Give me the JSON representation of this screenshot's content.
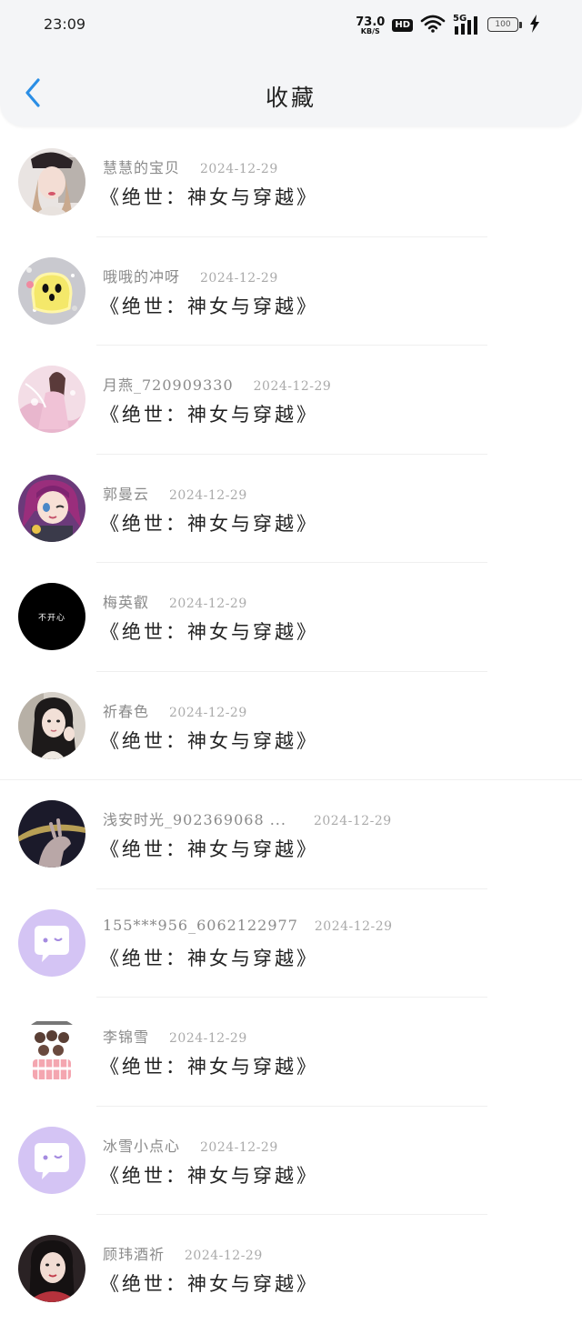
{
  "status_bar": {
    "time": "23:09",
    "net_speed": "73.0",
    "net_unit": "KB/S",
    "hd": "HD",
    "signal": "5G",
    "battery": "100"
  },
  "header": {
    "title": "收藏"
  },
  "colors": {
    "accent": "#2a8ee5",
    "bg": "#ffffff",
    "header_bg": "#f4f5f7"
  },
  "items": [
    {
      "name": "慧慧的宝贝",
      "date": "2024-12-29",
      "book": "《绝世：神女与穿越》",
      "avatar_icon": "photo-girl-red-beret-icon"
    },
    {
      "name": "哦哦的冲呀",
      "date": "2024-12-29",
      "book": "《绝世：神女与穿越》",
      "avatar_icon": "cartoon-chick-icon"
    },
    {
      "name": "月燕_720909330",
      "date": "2024-12-29",
      "book": "《绝世：神女与穿越》",
      "avatar_icon": "anime-fairy-pink-icon"
    },
    {
      "name": "郭曼云",
      "date": "2024-12-29",
      "book": "《绝世：神女与穿越》",
      "avatar_icon": "anime-girl-purple-icon"
    },
    {
      "name": "梅英叡",
      "date": "2024-12-29",
      "book": "《绝世：神女与穿越》",
      "avatar_icon": "black-circle-text-icon",
      "avatar_text": "不开心"
    },
    {
      "name": "祈春色",
      "date": "2024-12-29",
      "book": "《绝世：神女与穿越》",
      "avatar_icon": "photo-girl-longhair-icon"
    },
    {
      "name": "浅安时光_902369068 ...",
      "date": "2024-12-29",
      "book": "《绝世：神女与穿越》",
      "avatar_icon": "dark-hand-photo-icon"
    },
    {
      "name": "155***956_6062122977",
      "date": "2024-12-29",
      "book": "《绝世：神女与穿越》",
      "avatar_icon": "default-chat-bubble-icon"
    },
    {
      "name": "李锦雪",
      "date": "2024-12-29",
      "book": "《绝世：神女与穿越》",
      "avatar_icon": "cartoon-group-icon"
    },
    {
      "name": "冰雪小点心",
      "date": "2024-12-29",
      "book": "《绝世：神女与穿越》",
      "avatar_icon": "default-chat-bubble-icon"
    },
    {
      "name": "顾玮酒祈",
      "date": "2024-12-29",
      "book": "《绝世：神女与穿越》",
      "avatar_icon": "photo-girl-portrait-icon"
    }
  ]
}
